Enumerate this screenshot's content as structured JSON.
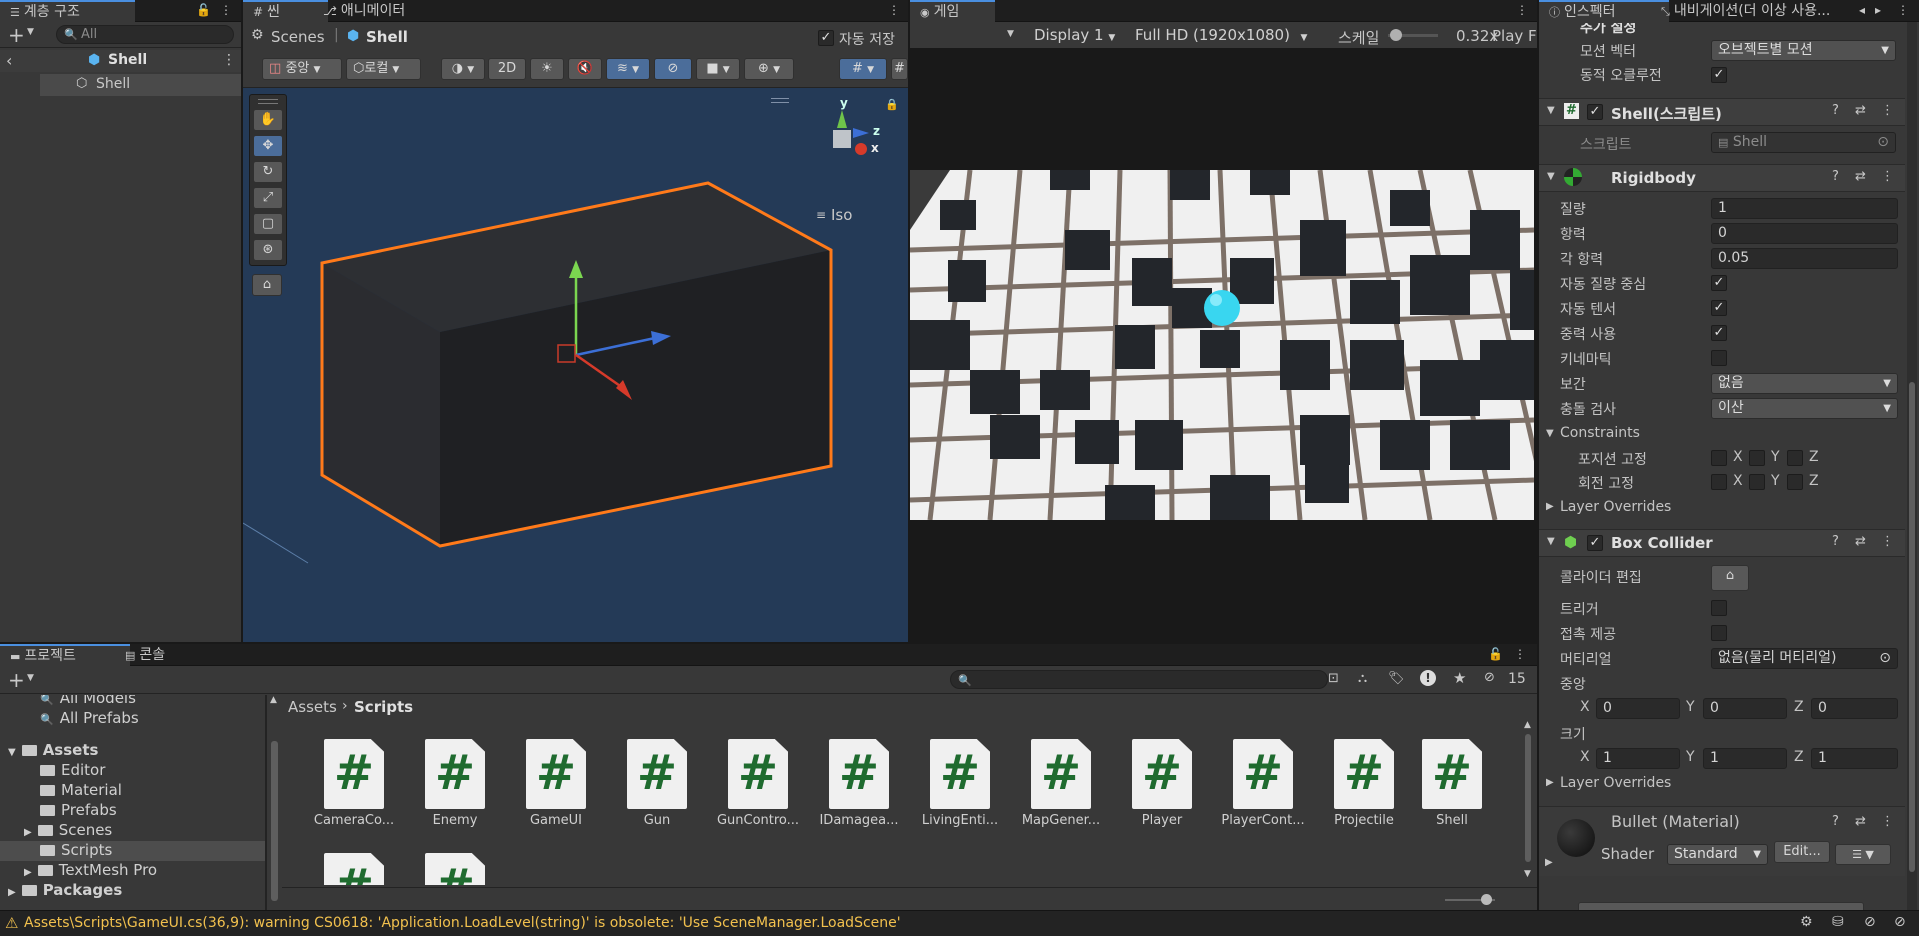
{
  "hierarchy": {
    "tab": "계층 구조",
    "search_placeholder": "All",
    "scene": "Shell",
    "items": [
      "Shell"
    ]
  },
  "scene_view": {
    "tabs": [
      "씬",
      "애니메이터"
    ],
    "breadcrumb_root": "Scenes",
    "breadcrumb_current": "Shell",
    "autosave_label": "자동 저장",
    "autosave_checked": true,
    "pivot_label": "중앙",
    "space_label": "로컬",
    "btn_2d": "2D",
    "projection": "Iso",
    "gizmo_axes": [
      "y",
      "z",
      "x"
    ]
  },
  "game_view": {
    "tab": "게임",
    "display": "Display 1",
    "resolution": "Full HD (1920x1080)",
    "scale_label": "스케일",
    "scale_value": "0.32x",
    "play_label": "Play F"
  },
  "inspector": {
    "tabs": [
      "인스펙터",
      "내비게이션(더 이상 사용..."
    ],
    "top_section": "추가 설정",
    "motion_vector_label": "모션 벡터",
    "motion_vector_value": "오브젝트별 모션",
    "dynamic_occlusion_label": "동적 오클루전",
    "script_component": {
      "title": "Shell(스크립트)",
      "script_label": "스크립트",
      "script_value": "Shell"
    },
    "rigidbody": {
      "title": "Rigidbody",
      "mass_label": "질량",
      "mass": "1",
      "drag_label": "항력",
      "drag": "0",
      "angular_drag_label": "각 항력",
      "angular_drag": "0.05",
      "auto_com_label": "자동 질량 중심",
      "auto_tensor_label": "자동 텐서",
      "use_gravity_label": "중력 사용",
      "kinematic_label": "키네마틱",
      "interpolate_label": "보간",
      "interpolate": "없음",
      "collision_label": "충돌 검사",
      "collision": "이산",
      "constraints_label": "Constraints",
      "freeze_pos_label": "포지션 고정",
      "freeze_rot_label": "회전 고정",
      "axes": [
        "X",
        "Y",
        "Z"
      ],
      "layer_overrides": "Layer Overrides"
    },
    "box_collider": {
      "title": "Box Collider",
      "edit_label": "콜라이더 편집",
      "trigger_label": "트리거",
      "contacts_label": "접촉 제공",
      "material_label": "머티리얼",
      "material_value": "없음(물리 머티리얼)",
      "center_label": "중앙",
      "center": [
        "0",
        "0",
        "0"
      ],
      "size_label": "크기",
      "size": [
        "1",
        "1",
        "1"
      ],
      "axes": [
        "X",
        "Y",
        "Z"
      ],
      "layer_overrides": "Layer Overrides"
    },
    "material": {
      "name": "Bullet (Material)",
      "shader_label": "Shader",
      "shader_value": "Standard",
      "edit_button": "Edit..."
    }
  },
  "project": {
    "tabs": [
      "프로젝트",
      "콘솔"
    ],
    "hidden_count": "15",
    "favorites": [
      "All Models",
      "All Prefabs"
    ],
    "assets_root": "Assets",
    "folders": [
      "Editor",
      "Material",
      "Prefabs",
      "Scenes",
      "Scripts",
      "TextMesh Pro"
    ],
    "packages": "Packages",
    "breadcrumb": [
      "Assets",
      "Scripts"
    ],
    "files": [
      "CameraCo...",
      "Enemy",
      "GameUI",
      "Gun",
      "GunContro...",
      "IDamagea...",
      "LivingEnti...",
      "MapGener...",
      "Player",
      "PlayerCont...",
      "Projectile",
      "Shell"
    ]
  },
  "status_bar": {
    "warning": "Assets\\Scripts\\GameUI.cs(36,9): warning CS0618: 'Application.LoadLevel(string)' is obsolete: 'Use SceneManager.LoadScene'"
  },
  "colors": {
    "accent": "#4a8fe0",
    "selection": "#ff7a1a",
    "warning": "#f2c14e",
    "script_hash": "#1f6b2f"
  }
}
